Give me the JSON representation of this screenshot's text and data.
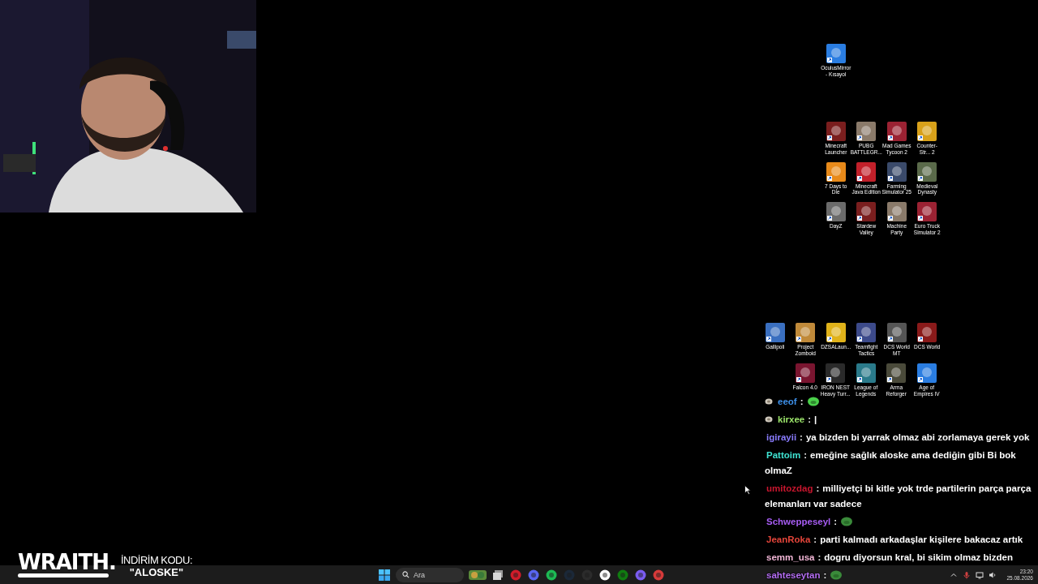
{
  "desktop": {
    "icon_groups": [
      {
        "icons": [
          {
            "label": "OculusMirror - Kısayol"
          }
        ]
      },
      {
        "icons": [
          {
            "label": "Minecraft Launcher"
          },
          {
            "label": "PUBG BATTLEGR..."
          },
          {
            "label": "Mad Games Tycoon 2"
          },
          {
            "label": "Counter-Str... 2"
          },
          {
            "label": "7 Days to Die"
          },
          {
            "label": "Minecraft Java Edition"
          },
          {
            "label": "Farming Simulator 25"
          },
          {
            "label": "Medieval Dynasty"
          },
          {
            "label": "DayZ"
          },
          {
            "label": "Stardew Valley"
          },
          {
            "label": "Machine Party"
          },
          {
            "label": "Euro Truck Simulator 2"
          }
        ]
      },
      {
        "icons": [
          {
            "label": "Gallipoli"
          },
          {
            "label": "Project Zomboid"
          },
          {
            "label": "DZSALaun..."
          },
          {
            "label": "Teamfight Tactics"
          },
          {
            "label": "DCS World MT"
          },
          {
            "label": "DCS World"
          }
        ]
      },
      {
        "icons": [
          {
            "label": "Falcon 4.0"
          },
          {
            "label": "IRON NEST Heavy Turr..."
          },
          {
            "label": "League of Legends"
          },
          {
            "label": "Arma Reforger"
          },
          {
            "label": "Age of Empires IV"
          }
        ]
      }
    ]
  },
  "chat": {
    "messages": [
      {
        "user": "eeof",
        "separator": ":",
        "color": "#3d8fe8",
        "badge": true,
        "kind": "emote"
      },
      {
        "user": "kirxee",
        "separator": ":",
        "color": "#9be46a",
        "badge": true,
        "kind": "text",
        "text": "|"
      },
      {
        "user": "igirayii",
        "separator": ":",
        "color": "#8a7cff",
        "badge": false,
        "kind": "text",
        "text": "ya bizden bi yarrak olmaz abi zorlamaya gerek yok"
      },
      {
        "user": "Pattoim",
        "separator": ":",
        "color": "#3fe3d2",
        "badge": false,
        "kind": "text",
        "text": "emeğine sağlık aloske ama dediğin gibi Bi bok",
        "continuation": "olmaZ"
      },
      {
        "user": "umitozdag",
        "separator": ":",
        "color": "#c8162e",
        "badge": false,
        "kind": "text",
        "text": "milliyetçi bi kitle yok trde partilerin parça parça",
        "continuation": "elemanları var sadece"
      },
      {
        "user": "Schweppeseyl",
        "separator": ":",
        "color": "#a65cf2",
        "badge": false,
        "kind": "emote"
      },
      {
        "user": "JeanRoka",
        "separator": ":",
        "color": "#e4453a",
        "badge": false,
        "kind": "text",
        "text": "parti kalmadı arkadaşlar kişilere bakacaz artık"
      },
      {
        "user": "semm_usa",
        "separator": ":",
        "color": "#f2b6d6",
        "badge": false,
        "kind": "text",
        "text": "dogru diyorsun kral, bi sikim olmaz bizden"
      },
      {
        "user": "sahteseytan",
        "separator": ":",
        "color": "#b46ef2",
        "badge": false,
        "kind": "emote"
      }
    ]
  },
  "promo": {
    "brand": "WRAITH.",
    "line_1": "İNDİRİM KODU:",
    "line_2": "\"ALOSKE\""
  },
  "taskbar": {
    "search": {
      "placeholder": "Ara"
    },
    "clock": {
      "time": "23:20",
      "date": "25.08.2026"
    }
  }
}
